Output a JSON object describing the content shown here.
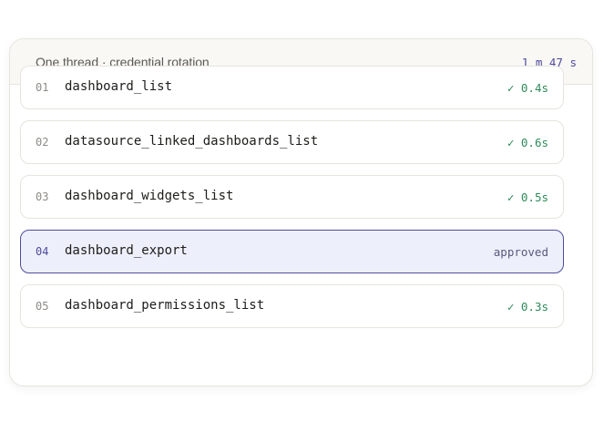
{
  "header": {
    "title": "One thread · credential rotation",
    "elapsed": "1 m 47 s"
  },
  "rows": [
    {
      "num": "01",
      "name": "dashboard_list",
      "status": "✓ 0.4s",
      "state": "done"
    },
    {
      "num": "02",
      "name": "datasource_linked_dashboards_list",
      "status": "✓ 0.6s",
      "state": "done"
    },
    {
      "num": "03",
      "name": "dashboard_widgets_list",
      "status": "✓ 0.5s",
      "state": "done"
    },
    {
      "num": "04",
      "name": "dashboard_export",
      "status": "approved",
      "state": "approved"
    },
    {
      "num": "05",
      "name": "dashboard_permissions_list",
      "status": "✓ 0.3s",
      "state": "done"
    }
  ],
  "colors": {
    "accent": "#4f4d9e",
    "success": "#2f8a5a",
    "active_bg": "#edeffb"
  }
}
